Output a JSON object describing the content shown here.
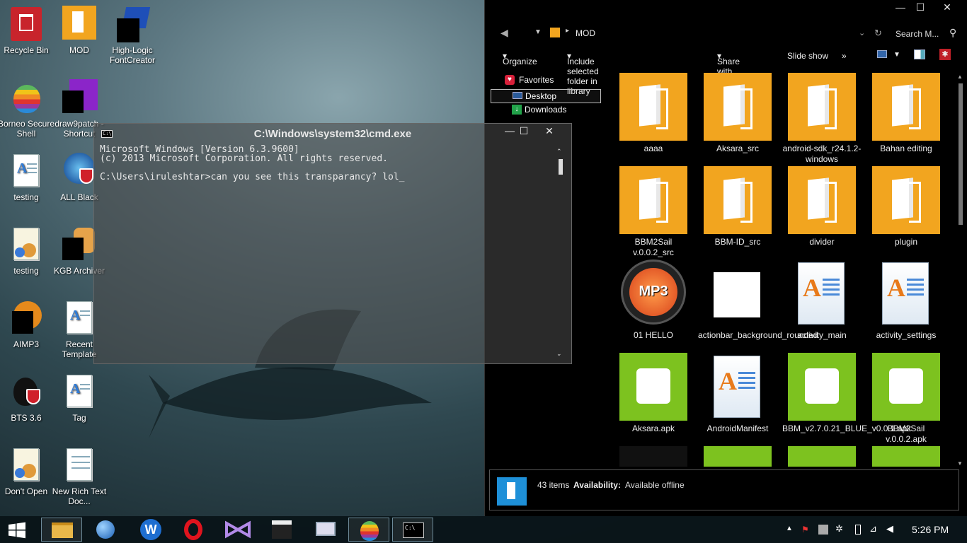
{
  "desktop": {
    "icons": [
      {
        "label": "Recycle Bin"
      },
      {
        "label": "MOD"
      },
      {
        "label": "High-Logic FontCreator"
      },
      {
        "label": "Borneo Secure Shell"
      },
      {
        "label": "draw9patch - Shortcut"
      },
      {
        "label": "testing"
      },
      {
        "label": "ALL Black"
      },
      {
        "label": "testing"
      },
      {
        "label": "KGB Archiver"
      },
      {
        "label": "AIMP3"
      },
      {
        "label": "Recent Template"
      },
      {
        "label": "BTS 3.6"
      },
      {
        "label": "Tag"
      },
      {
        "label": "Don't Open"
      },
      {
        "label": "New Rich Text Doc..."
      }
    ]
  },
  "cmd": {
    "title": "C:\\Windows\\system32\\cmd.exe",
    "icon_text": "C:\\",
    "lines": [
      "Microsoft Windows [Version 6.3.9600]",
      "(c) 2013 Microsoft Corporation. All rights reserved.",
      "",
      "C:\\Users\\iruleshtar>can you see this transparancy? lol_"
    ],
    "minimize": "—",
    "maximize": "☐",
    "close": "✕"
  },
  "explorer": {
    "path": "MOD",
    "search_placeholder": "Search M...",
    "toolbar": {
      "organize": "Organize",
      "include": "Include selected folder in library",
      "share": "Share with",
      "slideshow": "Slide show",
      "more": "»"
    },
    "nav": {
      "favorites": "Favorites",
      "desktop": "Desktop",
      "downloads": "Downloads"
    },
    "items": [
      {
        "name": "aaaa",
        "kind": "folder"
      },
      {
        "name": "Aksara_src",
        "kind": "folder"
      },
      {
        "name": "android-sdk_r24.1.2-windows",
        "kind": "folder"
      },
      {
        "name": "Bahan editing",
        "kind": "folder"
      },
      {
        "name": "BBM2Sail v.0.0.2_src",
        "kind": "folder"
      },
      {
        "name": "BBM-ID_src",
        "kind": "folder"
      },
      {
        "name": "divider",
        "kind": "folder"
      },
      {
        "name": "plugin",
        "kind": "folder"
      },
      {
        "name": "01 HELLO",
        "kind": "mp3"
      },
      {
        "name": "actionbar_background_rounded",
        "kind": "blank"
      },
      {
        "name": "activity_main",
        "kind": "doc"
      },
      {
        "name": "activity_settings",
        "kind": "doc"
      },
      {
        "name": "Aksara.apk",
        "kind": "apk"
      },
      {
        "name": "AndroidManifest",
        "kind": "doc"
      },
      {
        "name": "BBM_v2.7.0.21_BLUE_v0.0.1.apk",
        "kind": "apk"
      },
      {
        "name": "BBM2Sail v.0.0.2.apk",
        "kind": "apk"
      }
    ],
    "mp3_label": "MP3",
    "status": {
      "count": "43 items",
      "availability_label": "Availability:",
      "availability_value": "Available offline"
    },
    "window_minimize": "—",
    "window_maximize": "☐",
    "window_close": "✕"
  },
  "taskbar": {
    "clock": "5:26 PM",
    "cmd_icon_text": "C:\\"
  }
}
